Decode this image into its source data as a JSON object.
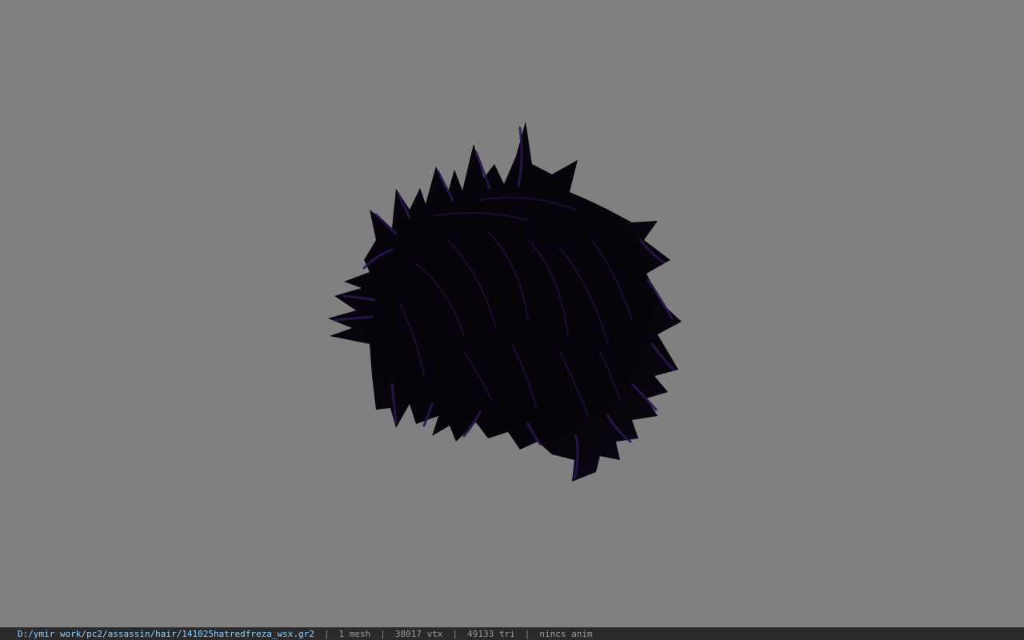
{
  "viewport": {
    "background_color": "#808080",
    "model": {
      "icon": "spiky-hair-mesh",
      "base_color": "#030206",
      "highlight_color": "#3a1f66"
    }
  },
  "status_bar": {
    "path": "D:/ymir work/pc2/assassin/hair/141025hatredfreza_wsx.gr2",
    "separator": "|",
    "mesh_count": "1 mesh",
    "vertex_count": "38017 vtx",
    "triangle_count": "49133 tri",
    "anim_status": "nincs anim",
    "path_color": "#8fd0ff"
  }
}
